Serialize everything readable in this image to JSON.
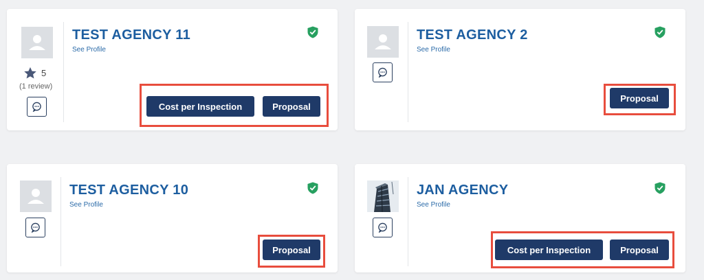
{
  "agencies": [
    {
      "name": "TEST AGENCY 11",
      "see_profile": "See Profile",
      "rating": "5",
      "reviews": "(1 review)",
      "cost_label": "Cost per Inspection",
      "proposal_label": "Proposal"
    },
    {
      "name": "TEST AGENCY 2",
      "see_profile": "See Profile",
      "proposal_label": "Proposal"
    },
    {
      "name": "TEST AGENCY 10",
      "see_profile": "See Profile",
      "proposal_label": "Proposal"
    },
    {
      "name": "JAN AGENCY",
      "see_profile": "See Profile",
      "cost_label": "Cost per Inspection",
      "proposal_label": "Proposal"
    }
  ],
  "colors": {
    "title": "#1d5ea0",
    "button": "#1f3a68",
    "highlight": "#e84d3d",
    "verified": "#27a060"
  },
  "icons": {
    "verified": "shield-check-icon",
    "chat": "chat-bubble-icon",
    "star": "star-icon",
    "avatar": "user-placeholder-icon"
  }
}
